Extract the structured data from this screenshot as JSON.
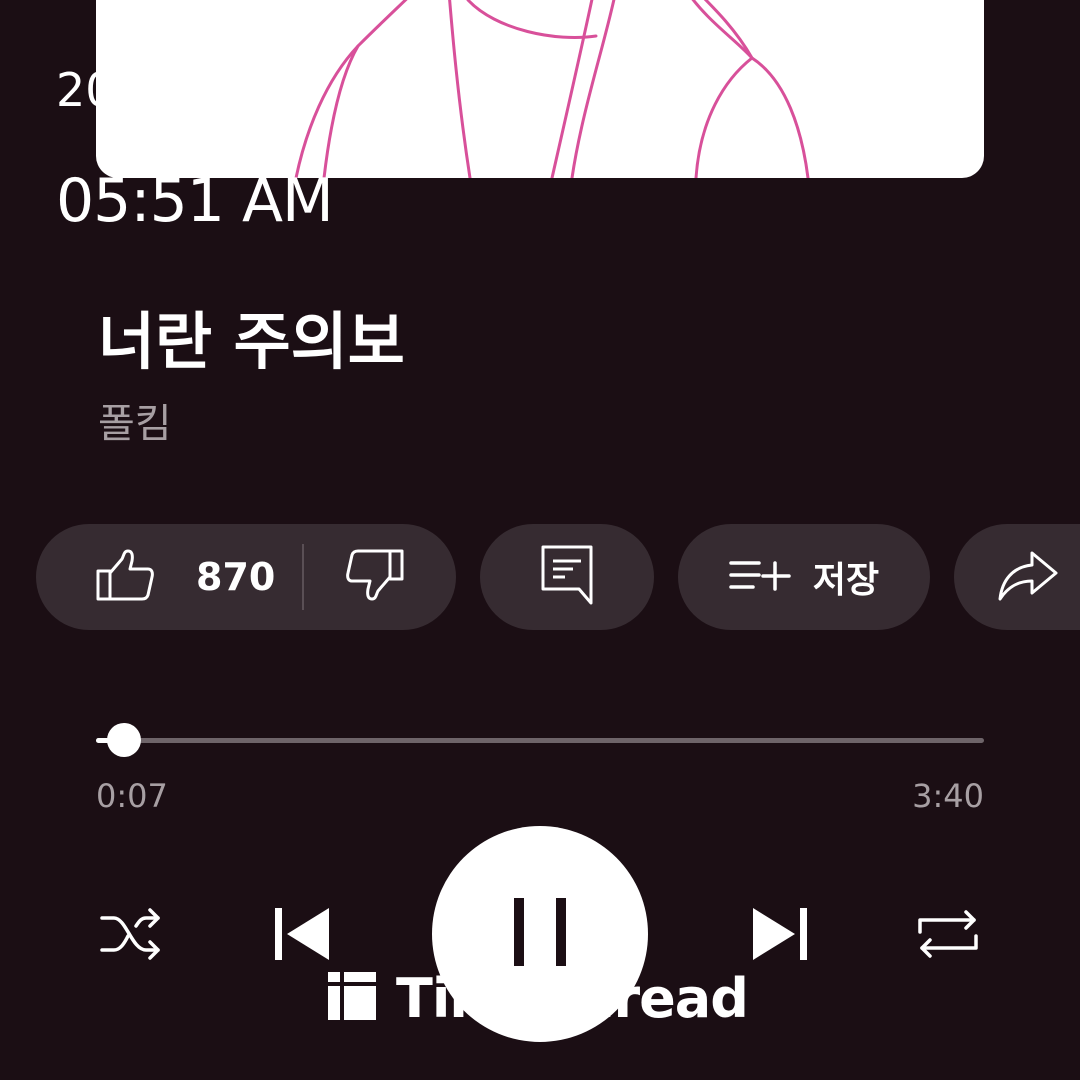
{
  "overlay": {
    "date_partial": "20",
    "time": "05:51 AM"
  },
  "album_art": {
    "description_icon": "album-art-illustration",
    "line_color": "#d8509a"
  },
  "song": {
    "title": "너란 주의보",
    "artist": "폴킴"
  },
  "actions": {
    "like_icon": "thumbs-up-icon",
    "like_count": "870",
    "dislike_icon": "thumbs-down-icon",
    "comment_icon": "comment-icon",
    "save_icon": "playlist-add-icon",
    "save_label": "저장",
    "share_icon": "share-icon"
  },
  "progress": {
    "current_time": "0:07",
    "total_time": "3:40",
    "fraction": 0.032
  },
  "controls": {
    "shuffle_icon": "shuffle-icon",
    "previous_icon": "skip-previous-icon",
    "play_pause_icon": "pause-icon",
    "next_icon": "skip-next-icon",
    "repeat_icon": "repeat-icon"
  },
  "watermark": {
    "text": "TimeThread"
  },
  "colors": {
    "background": "#1b0e14",
    "pill": "#362b31",
    "secondary_text": "#a79fa3",
    "accent_white": "#ffffff"
  }
}
